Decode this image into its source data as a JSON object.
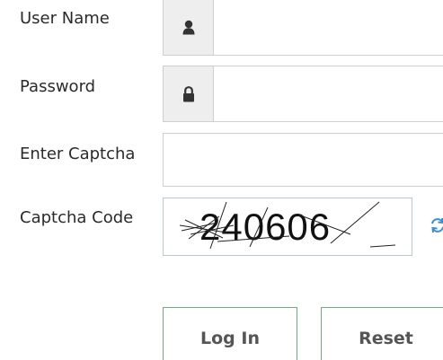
{
  "form": {
    "username": {
      "label": "User Name",
      "icon": "user-icon",
      "value": ""
    },
    "password": {
      "label": "Password",
      "icon": "lock-icon",
      "value": ""
    },
    "captcha_input": {
      "label": "Enter Captcha",
      "value": ""
    },
    "captcha": {
      "label": "Captcha Code",
      "code": "240606",
      "refresh_icon": "refresh-icon"
    }
  },
  "buttons": {
    "login": "Log In",
    "reset": "Reset"
  },
  "colors": {
    "addon_bg": "#eeeeee",
    "border": "#cfcfcf",
    "button_border": "#6fa884",
    "captcha_border": "#b5c7d9",
    "refresh": "#3a8fd4"
  }
}
